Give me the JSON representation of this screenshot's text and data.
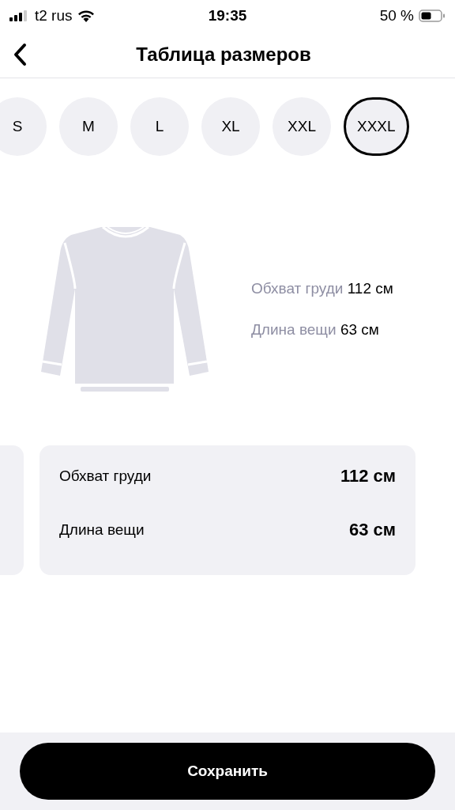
{
  "status_bar": {
    "carrier": "t2 rus",
    "time": "19:35",
    "battery": "50 %"
  },
  "header": {
    "title": "Таблица размеров"
  },
  "sizes": [
    {
      "label": "S",
      "selected": false
    },
    {
      "label": "M",
      "selected": false
    },
    {
      "label": "L",
      "selected": false
    },
    {
      "label": "XL",
      "selected": false
    },
    {
      "label": "XXL",
      "selected": false
    },
    {
      "label": "XXXL",
      "selected": true
    }
  ],
  "illustration": {
    "measurements": [
      "Обхват груди **112 см**",
      "Длина вещи **63 см**"
    ]
  },
  "card": {
    "rows": [
      {
        "label": "Обхват груди",
        "value": "112 см"
      },
      {
        "label": "Длина вещи",
        "value": "63 см"
      }
    ]
  },
  "footer": {
    "button": "Сохранить"
  }
}
